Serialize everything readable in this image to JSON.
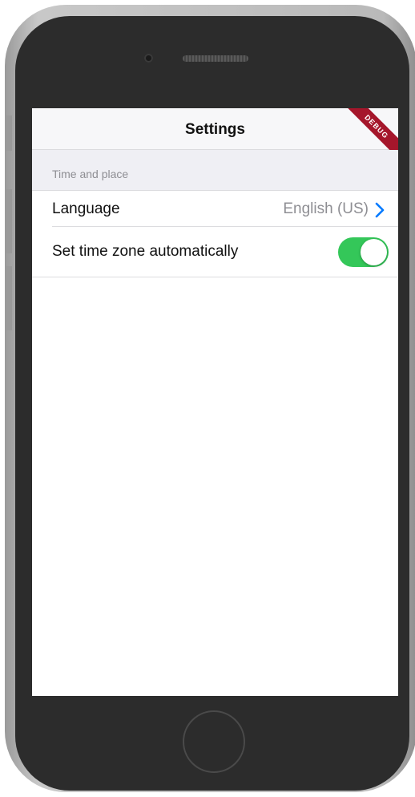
{
  "app": {
    "title": "Settings",
    "debug_badge": "DEBUG"
  },
  "sections": [
    {
      "header": "Time and place",
      "rows": [
        {
          "label": "Language",
          "value": "English (US)",
          "accessory": "chevron-right-icon"
        },
        {
          "label": "Set time zone automatically",
          "toggle_on": true
        }
      ]
    }
  ],
  "colors": {
    "accent": "#007aff",
    "toggle_on": "#34c759",
    "debug_ribbon": "#a5162b",
    "group_background": "#efeff4"
  }
}
